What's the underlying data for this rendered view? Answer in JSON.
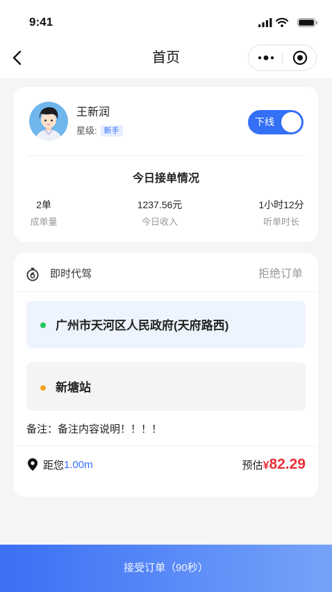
{
  "status_bar": {
    "time": "9:41"
  },
  "nav": {
    "title": "首页"
  },
  "driver": {
    "name": "王新润",
    "level_label": "星级:",
    "level_badge": "新手",
    "toggle_label": "下线",
    "toggle_on": true
  },
  "today": {
    "title": "今日接单情况",
    "stats": [
      {
        "value": "2单",
        "label": "成单量"
      },
      {
        "value": "1237.56元",
        "label": "今日收入"
      },
      {
        "value": "1小时12分",
        "label": "听单时长"
      }
    ]
  },
  "order": {
    "type": "即时代驾",
    "reject_label": "拒绝订单",
    "pickup": "广州市天河区人民政府(天府路西)",
    "dropoff": "新塘站",
    "remark": "备注：备注内容说明！！！！",
    "distance_label": "距您",
    "distance_value": "1.00m",
    "estimate_label": "预估",
    "currency": "¥",
    "amount": "82.29"
  },
  "action": {
    "accept_label": "接受订单（90秒）"
  },
  "colors": {
    "accent": "#3370f6",
    "price": "#e9303a",
    "pickup_dot": "#22c55e",
    "dropoff_dot": "#f5a623",
    "button_start": "#3b6ff5",
    "button_end": "#76a3f9"
  },
  "icons": {
    "signal": "signal-icon",
    "wifi": "wifi-icon",
    "battery": "battery-icon",
    "back": "chevron-left-icon",
    "more": "more-dots-icon",
    "target": "target-icon",
    "order_type": "stopwatch-icon",
    "distance": "location-pin-icon"
  }
}
